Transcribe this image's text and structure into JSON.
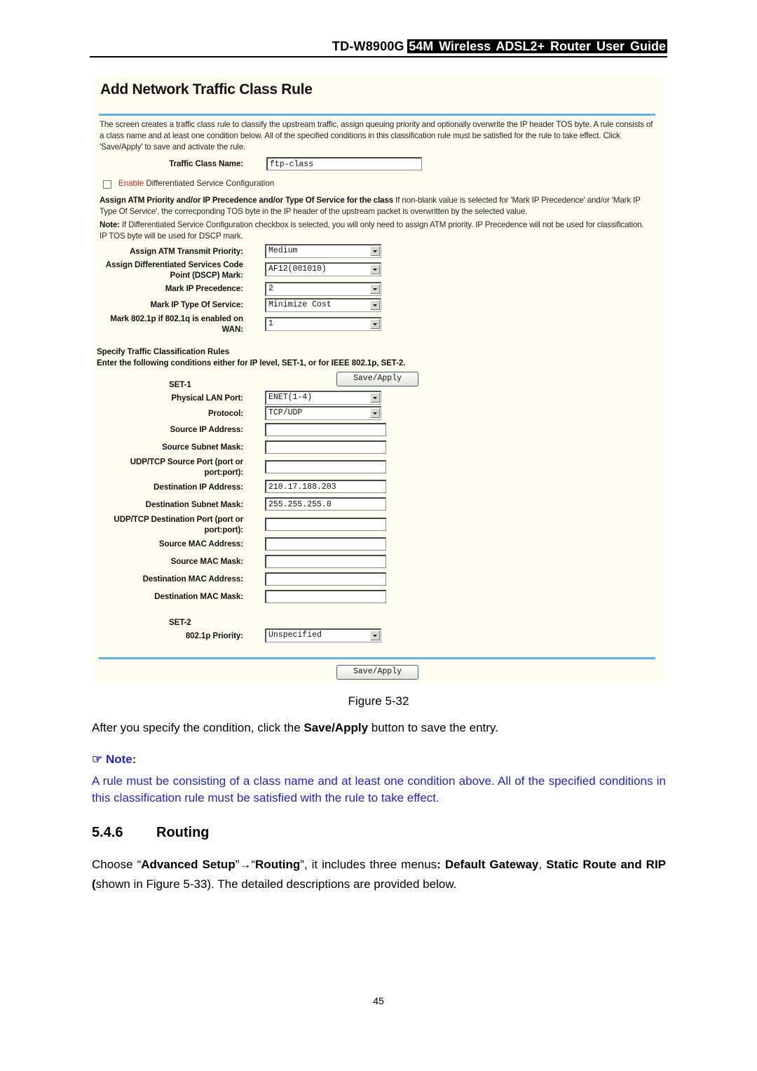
{
  "header": {
    "model": "TD-W8900G",
    "guide_title": "54M Wireless ADSL2+ Router User Guide"
  },
  "panel": {
    "title": "Add Network Traffic Class Rule",
    "intro": "The screen creates a traffic class rule to classify the upstream traffic, assign queuing priority and optionally overwrite the IP header TOS byte. A rule consists of a class name and at least one condition below. All of the specified conditions in this classification rule must be satisfied for the rule to take effect. Click 'Save/Apply' to save and activate the rule.",
    "traffic_class_name": {
      "label": "Traffic Class Name:",
      "value": "ftp-class"
    },
    "diffserv": {
      "checked": false,
      "enable_word": "Enable",
      "rest": " Differentiated Service Configuration"
    },
    "assign_heading": "Assign ATM Priority and/or IP Precedence and/or Type Of Service for the class",
    "assign_text": " If non-blank value is selected for 'Mark IP Precedence' and/or 'Mark IP Type Of Service', the correcponding TOS byte in the IP header of the upstream packet is overwritten by the selected value.",
    "note_label": "Note:",
    "note_text": " If Differentiated Service Configuration checkbox is selected, you will only need to assign ATM priority. IP Precedence will not be used for classification. IP TOS byte will be used for DSCP mark.",
    "marking": [
      {
        "label": "Assign ATM Transmit Priority:",
        "value": "Medium"
      },
      {
        "label": "Assign Differentiated Services Code Point (DSCP) Mark:",
        "value": "AF12(001010)"
      },
      {
        "label": "Mark IP Precedence:",
        "value": "2"
      },
      {
        "label": "Mark IP Type Of Service:",
        "value": "Minimize Cost"
      },
      {
        "label": "Mark 802.1p if 802.1q is enabled on WAN:",
        "value": "1"
      }
    ],
    "rules_heading": "Specify Traffic Classification Rules",
    "rules_subheading": "Enter the following conditions either for IP level, SET-1, or for IEEE 802.1p, SET-2.",
    "save_apply": "Save/Apply",
    "set1": {
      "label": "SET-1",
      "physical_lan_port": {
        "label": "Physical LAN Port:",
        "value": "ENET(1-4)"
      },
      "protocol": {
        "label": "Protocol:",
        "value": "TCP/UDP"
      },
      "fields": [
        {
          "label": "Source IP Address:",
          "value": ""
        },
        {
          "label": "Source Subnet Mask:",
          "value": ""
        },
        {
          "label": "UDP/TCP Source Port (port or port:port):",
          "value": ""
        },
        {
          "label": "Destination IP Address:",
          "value": "210.17.188.203"
        },
        {
          "label": "Destination Subnet Mask:",
          "value": "255.255.255.0"
        },
        {
          "label": "UDP/TCP Destination Port (port or port:port):",
          "value": ""
        },
        {
          "label": "Source MAC Address:",
          "value": ""
        },
        {
          "label": "Source MAC Mask:",
          "value": ""
        },
        {
          "label": "Destination MAC Address:",
          "value": ""
        },
        {
          "label": "Destination MAC Mask:",
          "value": ""
        }
      ]
    },
    "set2": {
      "label": "SET-2",
      "priority": {
        "label": "802.1p Priority:",
        "value": "Unspecified"
      }
    }
  },
  "doc": {
    "figure_caption": "Figure 5-32",
    "after_text_1": "After you specify the condition, click the ",
    "after_bold": "Save/Apply",
    "after_text_2": " button to save the entry.",
    "note_icon": "☞",
    "note_head": "Note:",
    "note_body": "A rule must be consisting of a class name and at least one condition above. All of the specified conditions in this classification rule must be satisfied with the rule to take effect.",
    "section_number": "5.4.6",
    "section_title": "Routing",
    "choose_1": "Choose “",
    "choose_b1": "Advanced Setup",
    "choose_arrow": "”→“",
    "choose_b2": "Routing",
    "choose_2": "”, it includes three menus",
    "choose_b3": ": Default Gateway",
    "choose_3": ", ",
    "choose_b4": "Static Route and RIP (",
    "choose_4": "shown in Figure 5-33). The detailed descriptions are provided below.",
    "page_number": "45"
  }
}
